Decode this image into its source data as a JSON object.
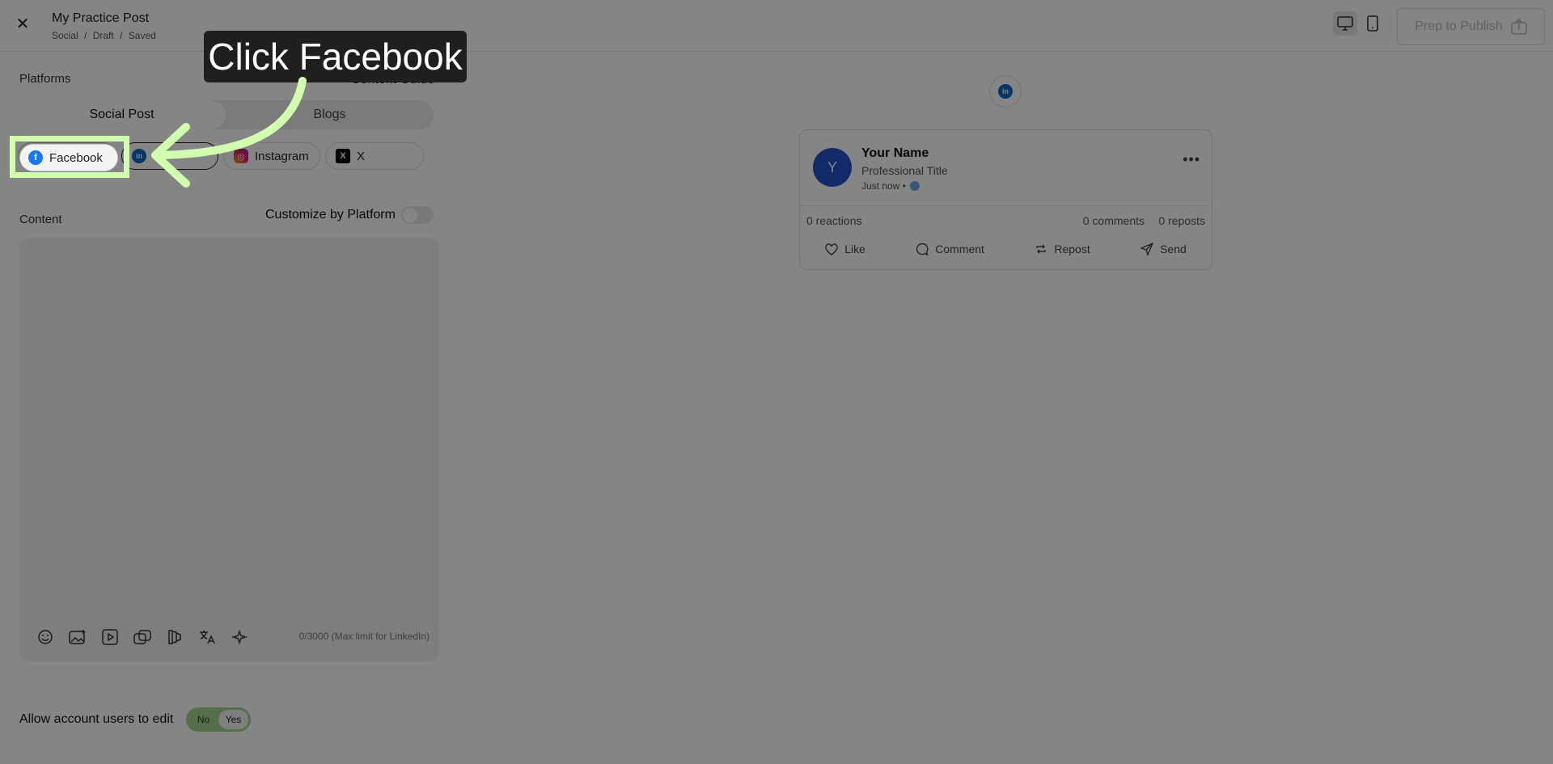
{
  "header": {
    "close_icon": "✕",
    "title": "My Practice Post",
    "breadcrumbs": [
      "Social",
      "/",
      "Draft",
      "/",
      "Saved"
    ],
    "publish_label": "Prep to Publish"
  },
  "left": {
    "platforms_label": "Platforms",
    "content_guide": "Content Guide",
    "tabs": [
      {
        "label": "Social Post",
        "active": true
      },
      {
        "label": "Blogs",
        "active": false
      }
    ],
    "platform_pills": [
      {
        "label": "Facebook",
        "icon": "facebook-icon"
      },
      {
        "label": "",
        "icon": "linkedin-icon"
      },
      {
        "label": "Instagram",
        "icon": "instagram-icon"
      },
      {
        "label": "X",
        "icon": "x-icon"
      }
    ],
    "content_label": "Content",
    "customize_label": "Customize by Platform",
    "counter": "0/3000 (Max limit for LinkedIn)",
    "allow_label": "Allow account users to edit",
    "no": "No",
    "yes": "Yes"
  },
  "preview": {
    "avatar_letter": "Y",
    "name": "Your Name",
    "title": "Professional Title",
    "time": "Just now •",
    "reactions": "0 reactions",
    "comments": "0 comments",
    "reposts": "0 reposts",
    "actions": [
      "Like",
      "Comment",
      "Repost",
      "Send"
    ]
  },
  "overlay": {
    "callout": "Click Facebook",
    "highlight_color": "#d2ffaf"
  }
}
